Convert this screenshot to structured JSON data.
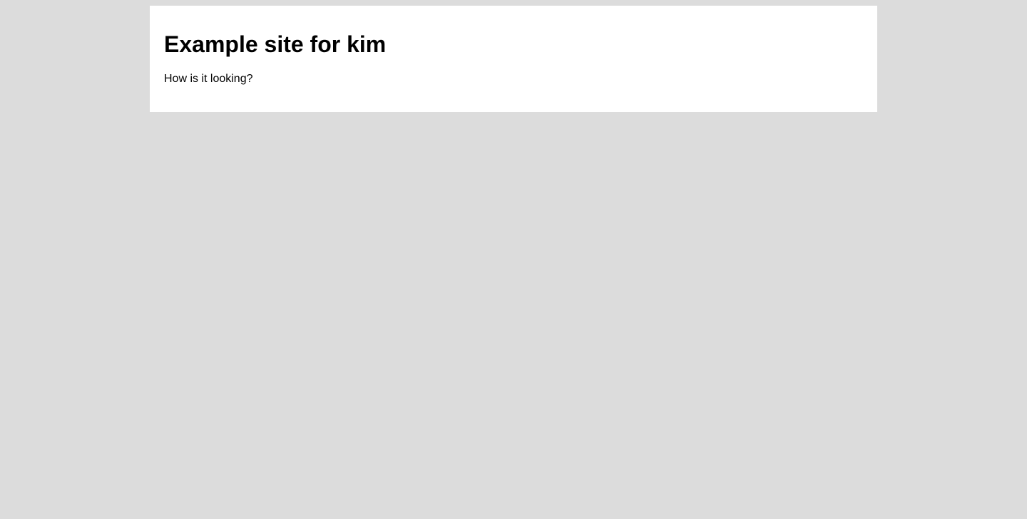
{
  "page": {
    "title": "Example site for kim",
    "body_text": "How is it looking?"
  },
  "colors": {
    "background": "#dcdcdc",
    "card": "#ffffff",
    "text": "#000000"
  }
}
